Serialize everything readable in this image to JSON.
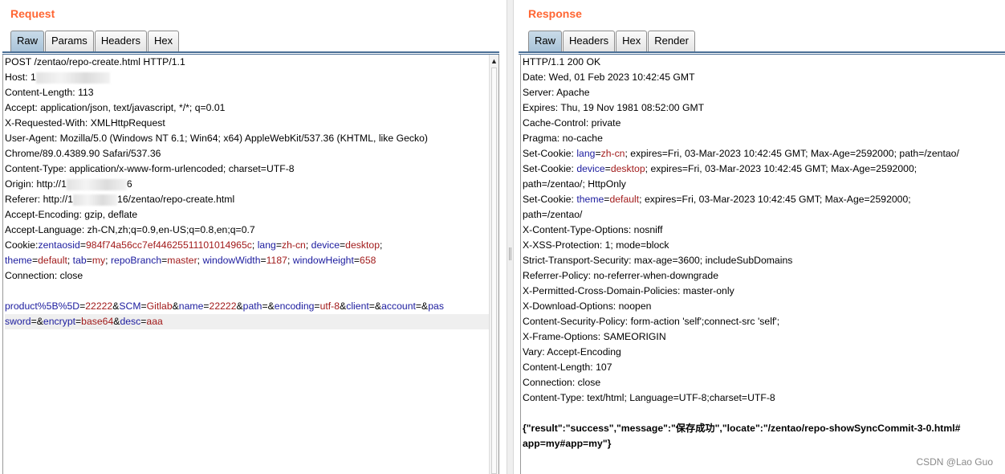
{
  "request": {
    "title": "Request",
    "tabs": [
      "Raw",
      "Params",
      "Headers",
      "Hex"
    ],
    "active_tab": "Raw",
    "lines": [
      [
        {
          "t": "POST /zentao/repo-create.html HTTP/1.1",
          "c": "p"
        }
      ],
      [
        {
          "t": "Host: 1",
          "c": "p"
        },
        {
          "blur": 92
        }
      ],
      [
        {
          "t": "Content-Length: 113",
          "c": "p"
        }
      ],
      [
        {
          "t": "Accept: application/json, text/javascript, */*; q=0.01",
          "c": "p"
        }
      ],
      [
        {
          "t": "X-Requested-With: XMLHttpRequest",
          "c": "p"
        }
      ],
      [
        {
          "t": "User-Agent: Mozilla/5.0 (Windows NT 6.1; Win64; x64) AppleWebKit/537.36 (KHTML, like Gecko)",
          "c": "p"
        }
      ],
      [
        {
          "t": "Chrome/89.0.4389.90 Safari/537.36",
          "c": "p"
        }
      ],
      [
        {
          "t": "Content-Type: application/x-www-form-urlencoded; charset=UTF-8",
          "c": "p"
        }
      ],
      [
        {
          "t": "Origin: http://1",
          "c": "p"
        },
        {
          "blur": 75
        },
        {
          "t": "6",
          "c": "p"
        }
      ],
      [
        {
          "t": "Referer: http://1",
          "c": "p"
        },
        {
          "blur": 55
        },
        {
          "t": "16/zentao/repo-create.html",
          "c": "p"
        }
      ],
      [
        {
          "t": "Accept-Encoding: gzip, deflate",
          "c": "p"
        }
      ],
      [
        {
          "t": "Accept-Language: zh-CN,zh;q=0.9,en-US;q=0.8,en;q=0.7",
          "c": "p"
        }
      ],
      [
        {
          "t": "Cookie:",
          "c": "p"
        },
        {
          "t": "zentaosid",
          "c": "n"
        },
        {
          "t": "=",
          "c": "p"
        },
        {
          "t": "984f74a56cc7ef44625511101014965c",
          "c": "v"
        },
        {
          "t": "; ",
          "c": "p"
        },
        {
          "t": "lang",
          "c": "n"
        },
        {
          "t": "=",
          "c": "p"
        },
        {
          "t": "zh-cn",
          "c": "v"
        },
        {
          "t": "; ",
          "c": "p"
        },
        {
          "t": "device",
          "c": "n"
        },
        {
          "t": "=",
          "c": "p"
        },
        {
          "t": "desktop",
          "c": "v"
        },
        {
          "t": ";",
          "c": "p"
        }
      ],
      [
        {
          "t": "theme",
          "c": "n"
        },
        {
          "t": "=",
          "c": "p"
        },
        {
          "t": "default",
          "c": "v"
        },
        {
          "t": "; ",
          "c": "p"
        },
        {
          "t": "tab",
          "c": "n"
        },
        {
          "t": "=",
          "c": "p"
        },
        {
          "t": "my",
          "c": "v"
        },
        {
          "t": "; ",
          "c": "p"
        },
        {
          "t": "repoBranch",
          "c": "n"
        },
        {
          "t": "=",
          "c": "p"
        },
        {
          "t": "master",
          "c": "v"
        },
        {
          "t": "; ",
          "c": "p"
        },
        {
          "t": "windowWidth",
          "c": "n"
        },
        {
          "t": "=",
          "c": "p"
        },
        {
          "t": "1187",
          "c": "v"
        },
        {
          "t": "; ",
          "c": "p"
        },
        {
          "t": "windowHeight",
          "c": "n"
        },
        {
          "t": "=",
          "c": "p"
        },
        {
          "t": "658",
          "c": "v"
        }
      ],
      [
        {
          "t": "Connection: close",
          "c": "p"
        }
      ],
      [],
      [
        {
          "t": "product%5B%5D",
          "c": "n"
        },
        {
          "t": "=",
          "c": "p"
        },
        {
          "t": "22222",
          "c": "v"
        },
        {
          "t": "&",
          "c": "p"
        },
        {
          "t": "SCM",
          "c": "n"
        },
        {
          "t": "=",
          "c": "p"
        },
        {
          "t": "Gitlab",
          "c": "v"
        },
        {
          "t": "&",
          "c": "p"
        },
        {
          "t": "name",
          "c": "n"
        },
        {
          "t": "=",
          "c": "p"
        },
        {
          "t": "22222",
          "c": "v"
        },
        {
          "t": "&",
          "c": "p"
        },
        {
          "t": "path",
          "c": "n"
        },
        {
          "t": "=&",
          "c": "p"
        },
        {
          "t": "encoding",
          "c": "n"
        },
        {
          "t": "=",
          "c": "p"
        },
        {
          "t": "utf-8",
          "c": "v"
        },
        {
          "t": "&",
          "c": "p"
        },
        {
          "t": "client",
          "c": "n"
        },
        {
          "t": "=&",
          "c": "p"
        },
        {
          "t": "account",
          "c": "n"
        },
        {
          "t": "=&",
          "c": "p"
        },
        {
          "t": "pas",
          "c": "n"
        }
      ],
      [
        {
          "t": "sword",
          "c": "n"
        },
        {
          "t": "=&",
          "c": "p"
        },
        {
          "t": "encrypt",
          "c": "n"
        },
        {
          "t": "=",
          "c": "p"
        },
        {
          "t": "base64",
          "c": "v"
        },
        {
          "t": "&",
          "c": "p"
        },
        {
          "t": "desc",
          "c": "n"
        },
        {
          "t": "=",
          "c": "p"
        },
        {
          "t": "aaa",
          "c": "v"
        }
      ]
    ],
    "highlight_line_index": 17
  },
  "response": {
    "title": "Response",
    "tabs": [
      "Raw",
      "Headers",
      "Hex",
      "Render"
    ],
    "active_tab": "Raw",
    "lines": [
      [
        {
          "t": "HTTP/1.1 200 OK",
          "c": "p"
        }
      ],
      [
        {
          "t": "Date: Wed, 01 Feb 2023 10:42:45 GMT",
          "c": "p"
        }
      ],
      [
        {
          "t": "Server: Apache",
          "c": "p"
        }
      ],
      [
        {
          "t": "Expires: Thu, 19 Nov 1981 08:52:00 GMT",
          "c": "p"
        }
      ],
      [
        {
          "t": "Cache-Control: private",
          "c": "p"
        }
      ],
      [
        {
          "t": "Pragma: no-cache",
          "c": "p"
        }
      ],
      [
        {
          "t": "Set-Cookie: ",
          "c": "p"
        },
        {
          "t": "lang",
          "c": "n"
        },
        {
          "t": "=",
          "c": "p"
        },
        {
          "t": "zh-cn",
          "c": "v"
        },
        {
          "t": "; expires=Fri, 03-Mar-2023 10:42:45 GMT; Max-Age=2592000; path=/zentao/",
          "c": "p"
        }
      ],
      [
        {
          "t": "Set-Cookie: ",
          "c": "p"
        },
        {
          "t": "device",
          "c": "n"
        },
        {
          "t": "=",
          "c": "p"
        },
        {
          "t": "desktop",
          "c": "v"
        },
        {
          "t": "; expires=Fri, 03-Mar-2023 10:42:45 GMT; Max-Age=2592000;",
          "c": "p"
        }
      ],
      [
        {
          "t": "path=/zentao/; HttpOnly",
          "c": "p"
        }
      ],
      [
        {
          "t": "Set-Cookie: ",
          "c": "p"
        },
        {
          "t": "theme",
          "c": "n"
        },
        {
          "t": "=",
          "c": "p"
        },
        {
          "t": "default",
          "c": "v"
        },
        {
          "t": "; expires=Fri, 03-Mar-2023 10:42:45 GMT; Max-Age=2592000;",
          "c": "p"
        }
      ],
      [
        {
          "t": "path=/zentao/",
          "c": "p"
        }
      ],
      [
        {
          "t": "X-Content-Type-Options: nosniff",
          "c": "p"
        }
      ],
      [
        {
          "t": "X-XSS-Protection: 1; mode=block",
          "c": "p"
        }
      ],
      [
        {
          "t": "Strict-Transport-Security: max-age=3600; includeSubDomains",
          "c": "p"
        }
      ],
      [
        {
          "t": "Referrer-Policy: no-referrer-when-downgrade",
          "c": "p"
        }
      ],
      [
        {
          "t": "X-Permitted-Cross-Domain-Policies: master-only",
          "c": "p"
        }
      ],
      [
        {
          "t": "X-Download-Options: noopen",
          "c": "p"
        }
      ],
      [
        {
          "t": "Content-Security-Policy: form-action 'self';connect-src 'self';",
          "c": "p"
        }
      ],
      [
        {
          "t": "X-Frame-Options: SAMEORIGIN",
          "c": "p"
        }
      ],
      [
        {
          "t": "Vary: Accept-Encoding",
          "c": "p"
        }
      ],
      [
        {
          "t": "Content-Length: 107",
          "c": "p"
        }
      ],
      [
        {
          "t": "Connection: close",
          "c": "p"
        }
      ],
      [
        {
          "t": "Content-Type: text/html; Language=UTF-8;charset=UTF-8",
          "c": "p"
        }
      ],
      [],
      [
        {
          "t": "{\"result\":\"success\",\"message\":\"保存成功\",\"locate\":\"/zentao/repo-showSyncCommit-3-0.html#",
          "c": "p bold"
        }
      ],
      [
        {
          "t": "app=my#app=my\"}",
          "c": "p bold"
        }
      ]
    ]
  },
  "watermark": "CSDN @Lao Guo",
  "scrollbar_up_icon": "triangle-up-icon"
}
